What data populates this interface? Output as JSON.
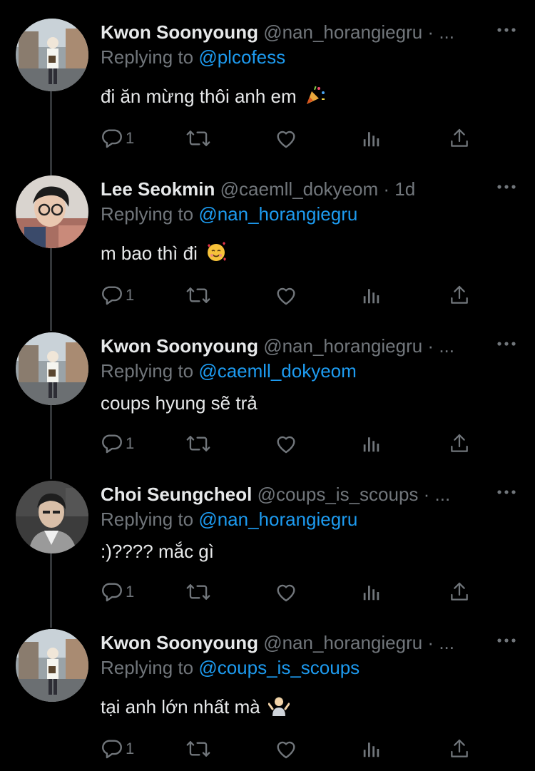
{
  "tweets": [
    {
      "display_name": "Kwon Soonyoung",
      "handle": "@nan_horangiegru · ...",
      "replying_prefix": "Replying to ",
      "replying_to": "@plcofess",
      "text": "đi ăn mừng thôi anh em",
      "emoji": "party-popper-emoji",
      "reply_count": "1",
      "avatar": "kwon-soonyoung-photo"
    },
    {
      "display_name": "Lee Seokmin",
      "handle": "@caemll_dokyeom · 1d",
      "replying_prefix": "Replying to ",
      "replying_to": "@nan_horangiegru",
      "text": "m bao thì đi",
      "emoji": "smiling-face-with-hearts-emoji",
      "reply_count": "1",
      "avatar": "lee-seokmin-photo"
    },
    {
      "display_name": "Kwon Soonyoung",
      "handle": "@nan_horangiegru · ...",
      "replying_prefix": "Replying to ",
      "replying_to": "@caemll_dokyeom",
      "text": "coups hyung sẽ trả",
      "emoji": "",
      "reply_count": "1",
      "avatar": "kwon-soonyoung-photo"
    },
    {
      "display_name": "Choi Seungcheol",
      "handle": "@coups_is_scoups · ...",
      "replying_prefix": "Replying to ",
      "replying_to": "@nan_horangiegru",
      "text": ":)???? mắc gì",
      "emoji": "",
      "reply_count": "1",
      "avatar": "choi-seungcheol-photo"
    },
    {
      "display_name": "Kwon Soonyoung",
      "handle": "@nan_horangiegru · ...",
      "replying_prefix": "Replying to ",
      "replying_to": "@coups_is_scoups",
      "text": "tại anh lớn nhất mà",
      "emoji": "person-shrugging-emoji",
      "reply_count": "1",
      "avatar": "kwon-soonyoung-photo"
    }
  ],
  "colors": {
    "background": "#000000",
    "text": "#e7e9ea",
    "muted": "#71767b",
    "link": "#1d9bf0",
    "thread_line": "#333639"
  },
  "icons": [
    "reply-icon",
    "retweet-icon",
    "like-icon",
    "analytics-icon",
    "share-icon",
    "more-icon"
  ]
}
